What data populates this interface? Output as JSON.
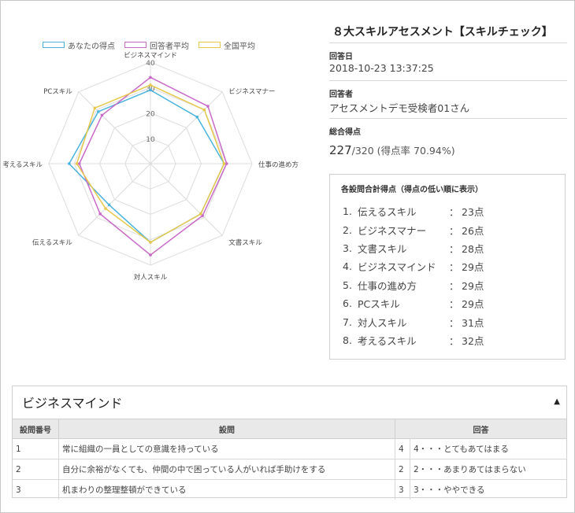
{
  "chart_data": {
    "type": "radar",
    "axes": [
      "ビジネスマインド",
      "ビジネスマナー",
      "仕事の進め方",
      "文書スキル",
      "対人スキル",
      "伝えるスキル",
      "考えるスキル",
      "PCスキル"
    ],
    "ticks": [
      10,
      20,
      30,
      40
    ],
    "range": [
      0,
      40
    ],
    "series": [
      {
        "name": "あなたの得点",
        "color": "#4ab4de",
        "values": [
          29,
          26,
          29,
          28,
          31,
          23,
          32,
          29
        ]
      },
      {
        "name": "回答者平均",
        "color": "#c86ac8",
        "values": [
          34,
          32,
          30,
          29,
          36,
          28,
          28,
          27
        ]
      },
      {
        "name": "全国平均",
        "color": "#e8c84a",
        "values": [
          31,
          30,
          29,
          28,
          31,
          25,
          29,
          31
        ]
      }
    ],
    "legend": "top"
  },
  "info": {
    "title": "８大スキルアセスメント【スキルチェック】",
    "date_label": "回答日",
    "date_value": "2018-10-23 13:37:25",
    "respondent_label": "回答者",
    "respondent_value": "アセスメントデモ受検者01さん",
    "total_label": "総合得点",
    "total_score": "227",
    "total_rest": "/320 (得点率 70.94%)"
  },
  "ranking": {
    "title": "各設問合計得点（得点の低い順に表示）",
    "items": [
      {
        "num": "1.",
        "name": "伝えるスキル",
        "score": "23点"
      },
      {
        "num": "2.",
        "name": "ビジネスマナー",
        "score": "26点"
      },
      {
        "num": "3.",
        "name": "文書スキル",
        "score": "28点"
      },
      {
        "num": "4.",
        "name": "ビジネスマインド",
        "score": "29点"
      },
      {
        "num": "5.",
        "name": "仕事の進め方",
        "score": "29点"
      },
      {
        "num": "6.",
        "name": "PCスキル",
        "score": "29点"
      },
      {
        "num": "7.",
        "name": "対人スキル",
        "score": "31点"
      },
      {
        "num": "8.",
        "name": "考えるスキル",
        "score": "32点"
      }
    ]
  },
  "section": {
    "title": "ビジネスマインド",
    "toggle": "▲",
    "headers": [
      "設問番号",
      "設問",
      "回答"
    ],
    "rows": [
      {
        "no": "1",
        "question": "常に組織の一員としての意識を持っている",
        "ans_no": "4",
        "ans_text": "4・・・とてもあてはまる"
      },
      {
        "no": "2",
        "question": "自分に余裕がなくても、仲間の中で困っている人がいれば手助けをする",
        "ans_no": "2",
        "ans_text": "2・・・あまりあてはまらない"
      },
      {
        "no": "3",
        "question": "机まわりの整理整頓ができている",
        "ans_no": "3",
        "ans_text": "3・・・ややできる"
      }
    ]
  }
}
